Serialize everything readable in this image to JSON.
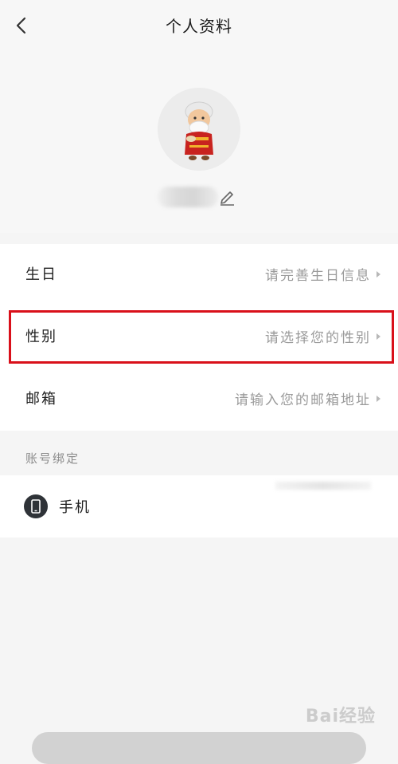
{
  "header": {
    "title": "个人资料",
    "back_icon": "chevron-left-icon"
  },
  "profile": {
    "avatar_icon": "cartoon-avatar",
    "edit_icon": "pencil-icon"
  },
  "fields": [
    {
      "label": "生日",
      "value": "请完善生日信息"
    },
    {
      "label": "性别",
      "value": "请选择您的性别"
    },
    {
      "label": "邮箱",
      "value": "请输入您的邮箱地址"
    }
  ],
  "binding": {
    "section_title": "账号绑定",
    "phone_label": "手机",
    "phone_icon": "mobile-phone-icon"
  },
  "highlight_color": "#d9101a",
  "watermark": "Bai经验"
}
